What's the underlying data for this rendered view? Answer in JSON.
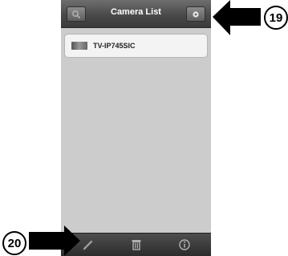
{
  "header": {
    "title": "Camera List"
  },
  "cameras": [
    {
      "name": "TV-IP745SIC"
    }
  ],
  "callouts": {
    "top_right": "19",
    "bottom_left": "20"
  },
  "icons": {
    "top_left": "search-icon",
    "top_right": "settings-icon",
    "bottom": [
      "edit-pencil-icon",
      "trash-icon",
      "info-icon"
    ]
  },
  "colors": {
    "titlebar": "#4a4a4a",
    "background": "#cccccc",
    "toolbar": "#2c2c2c"
  }
}
